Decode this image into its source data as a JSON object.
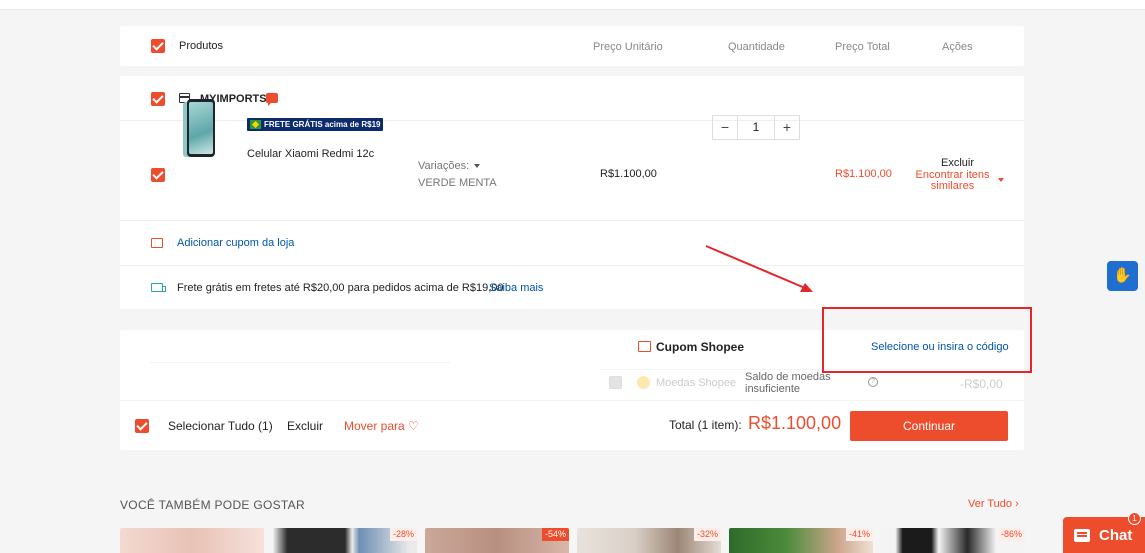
{
  "header": {
    "products": "Produtos",
    "unit_price": "Preço Unitário",
    "quantity": "Quantidade",
    "total_price": "Preço Total",
    "actions": "Ações"
  },
  "shop": {
    "name": "MYIMPORTS"
  },
  "item": {
    "name": "Celular Xiaomi Redmi 12c",
    "badge": "FRETE GRÁTIS acima de R$19",
    "variations_label": "Variações:",
    "variation_value": "VERDE MENTA",
    "unit_price": "R$1.100,00",
    "quantity": "1",
    "minus": "−",
    "plus": "+",
    "total": "R$1.100,00",
    "delete": "Excluir",
    "find_similar": "Encontrar itens similares"
  },
  "store_coupon": {
    "label": "Adicionar cupom da loja"
  },
  "shipping": {
    "text": "Frete grátis em fretes até R$20,00 para pedidos acima de R$19,00",
    "learn_more": "Saiba mais"
  },
  "summary": {
    "shopee_coupon": "Cupom Shopee",
    "select_code": "Selecione ou insira o código",
    "coins_label": "Moedas Shopee",
    "coins_status": "Saldo de moedas insuficiente",
    "coins_value": "-R$0,00",
    "select_all": "Selecionar Tudo (1)",
    "delete": "Excluir",
    "move_to": "Mover para ♡",
    "total_label": "Total (1 item):",
    "total_value": "R$1.100,00",
    "continue": "Continuar"
  },
  "recommendations": {
    "title": "VOCÊ TAMBÉM PODE GOSTAR",
    "see_all": "Ver Tudo ›",
    "discounts": [
      "",
      "-28%",
      "-54%",
      "-32%",
      "-41%",
      "-86%"
    ]
  },
  "chat": {
    "label": "Chat",
    "count": "1"
  },
  "accessibility_icon": "hand-sign-icon",
  "colors": {
    "primary": "#ee4d2d",
    "link": "#0055aa",
    "annotation": "#e3262a"
  }
}
